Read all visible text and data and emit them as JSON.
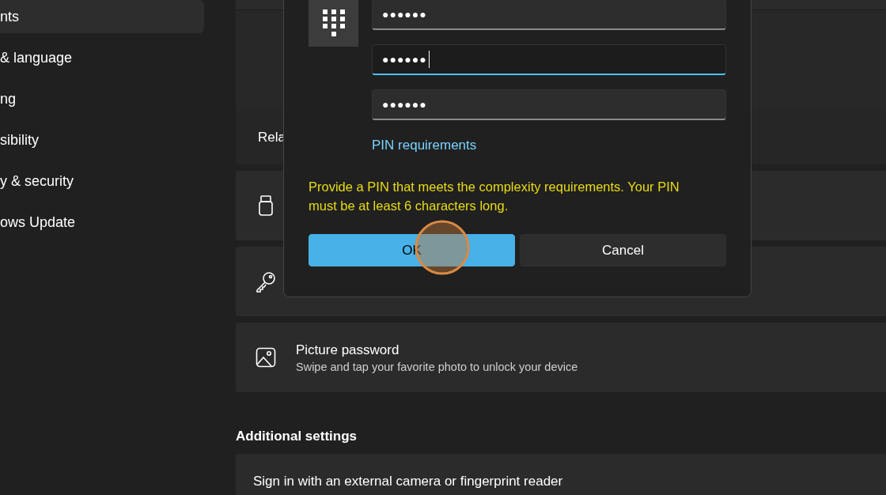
{
  "sidebar": {
    "items": [
      {
        "label": "nts",
        "selected": true
      },
      {
        "label": "& language",
        "selected": false
      },
      {
        "label": "ng",
        "selected": false
      },
      {
        "label": "sibility",
        "selected": false
      },
      {
        "label": "y & security",
        "selected": false
      },
      {
        "label": "ows Update",
        "selected": false
      }
    ]
  },
  "main": {
    "rows": [
      {
        "kind": "plain",
        "title": "Rela"
      },
      {
        "kind": "security-key"
      },
      {
        "kind": "key"
      },
      {
        "kind": "picture",
        "title": "Picture password",
        "subtitle": "Swipe and tap your favorite photo to unlock your device"
      }
    ],
    "additional_heading": "Additional settings",
    "additional_rows": [
      {
        "title": "Sign in with an external camera or fingerprint reader"
      }
    ]
  },
  "dialog": {
    "fields": [
      {
        "value": "●●●●●●",
        "focused": false
      },
      {
        "value": "●●●●●●",
        "focused": true
      },
      {
        "value": "●●●●●●",
        "focused": false
      }
    ],
    "link": "PIN requirements",
    "error": "Provide a PIN that meets the complexity requirements. Your PIN must be at least 6 characters long.",
    "buttons": [
      {
        "label": "OK",
        "primary": true
      },
      {
        "label": "Cancel",
        "primary": false
      }
    ]
  }
}
